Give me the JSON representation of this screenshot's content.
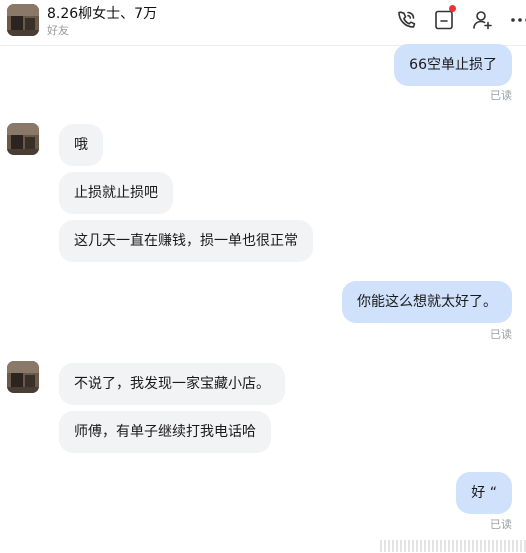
{
  "header": {
    "name": "8.26柳女士、7万",
    "subtitle": "好友"
  },
  "messages": [
    {
      "side": "out",
      "text": "66空单止损了",
      "status": "已读"
    },
    {
      "side": "in",
      "text": "哦"
    },
    {
      "side": "in",
      "text": "止损就止损吧"
    },
    {
      "side": "in",
      "text": "这几天一直在赚钱，损一单也很正常"
    },
    {
      "side": "out",
      "text": "你能这么想就太好了。",
      "status": "已读"
    },
    {
      "side": "in",
      "text": "不说了，我发现一家宝藏小店。"
    },
    {
      "side": "in",
      "text": "师傅，有单子继续打我电话哈"
    },
    {
      "side": "out",
      "text": "好 “",
      "status": "已读"
    }
  ],
  "icons": [
    "phone-icon",
    "note-icon",
    "add-user-icon",
    "more-icon"
  ],
  "colors": {
    "incoming_bubble": "#f2f3f5",
    "outgoing_bubble": "#cfe1fb",
    "notification_dot": "#f23030",
    "read_status": "#9aa0a6"
  }
}
